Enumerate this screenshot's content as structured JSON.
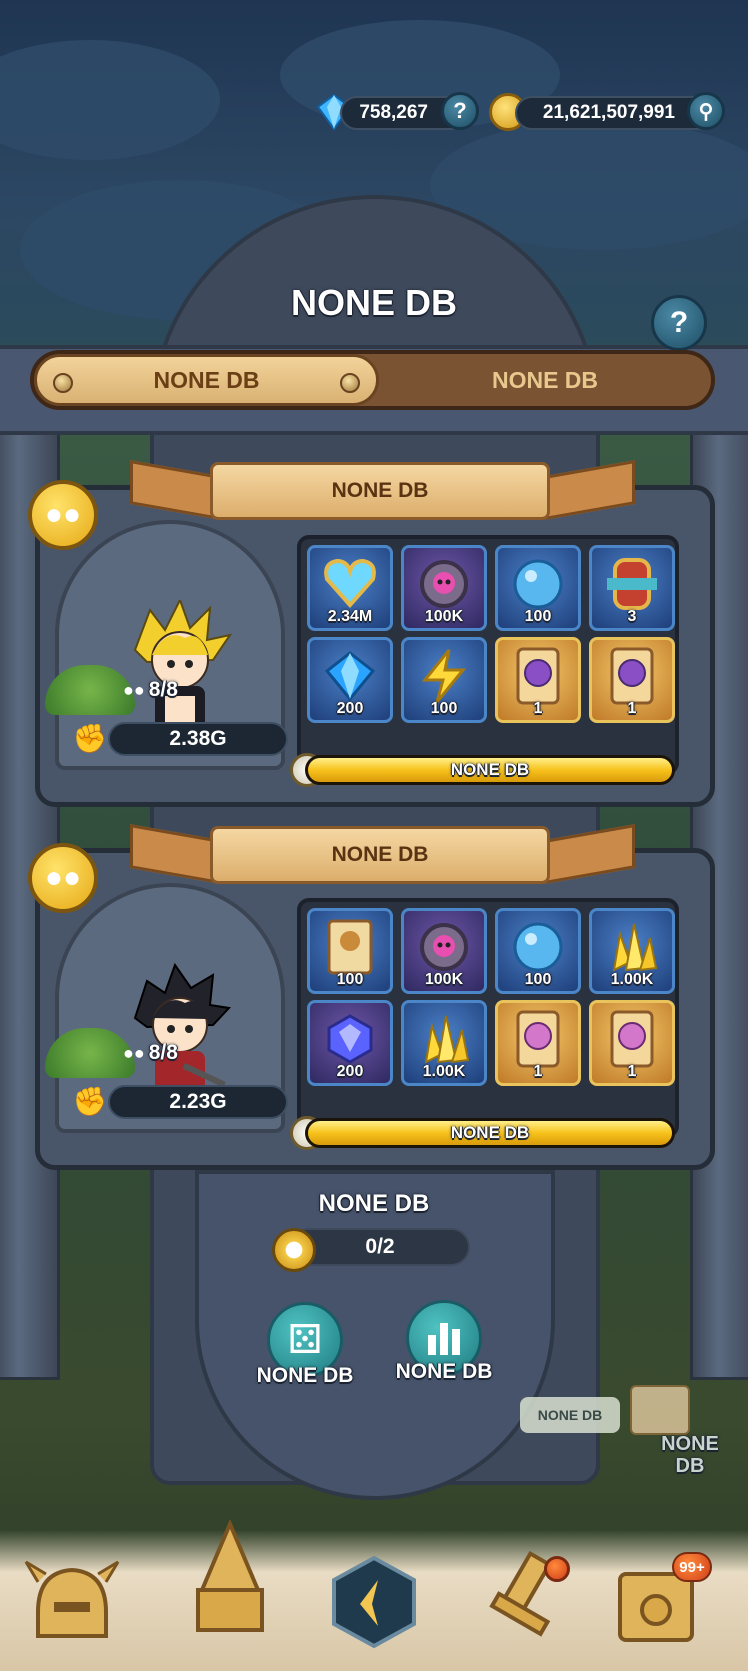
{
  "header": {
    "gems": "758,267",
    "gold": "21,621,507,991",
    "gems_help_icon": "question-icon",
    "gold_search_icon": "magnifier-icon"
  },
  "page": {
    "title": "NONE DB",
    "help_icon": "question-icon"
  },
  "tabs": [
    {
      "label": "NONE DB",
      "active": true
    },
    {
      "label": "NONE DB",
      "active": false
    }
  ],
  "panels": [
    {
      "banner": "NONE DB",
      "hero": "blonde-hero",
      "count": "8/8",
      "power": "2.38G",
      "progress_label": "NONE DB",
      "progress_percent": 100,
      "items": [
        {
          "icon": "heart-gem-icon",
          "qty": "2.34M",
          "style": "blue"
        },
        {
          "icon": "skull-token-icon",
          "qty": "100K",
          "style": "purple"
        },
        {
          "icon": "blue-orb-icon",
          "qty": "100",
          "style": "blue"
        },
        {
          "icon": "scroll-armor-icon",
          "qty": "3",
          "style": "blue"
        },
        {
          "icon": "diamond-icon",
          "qty": "200",
          "style": "blue"
        },
        {
          "icon": "lightning-icon",
          "qty": "100",
          "style": "blue"
        },
        {
          "icon": "tome-icon",
          "qty": "1",
          "style": "gold"
        },
        {
          "icon": "tome-icon",
          "qty": "1",
          "style": "gold"
        }
      ]
    },
    {
      "banner": "NONE DB",
      "hero": "dark-haired-hero",
      "count": "8/8",
      "power": "2.23G",
      "progress_label": "NONE DB",
      "progress_percent": 100,
      "items": [
        {
          "icon": "boar-hat-card-icon",
          "qty": "100",
          "style": "blue"
        },
        {
          "icon": "skull-token-icon",
          "qty": "100K",
          "style": "purple"
        },
        {
          "icon": "blue-orb-icon",
          "qty": "100",
          "style": "blue"
        },
        {
          "icon": "gold-crystal-icon",
          "qty": "1.00K",
          "style": "blue"
        },
        {
          "icon": "sapphire-icon",
          "qty": "200",
          "style": "purple"
        },
        {
          "icon": "gold-crystal-icon",
          "qty": "1.00K",
          "style": "blue"
        },
        {
          "icon": "tome-icon",
          "qty": "1",
          "style": "gold"
        },
        {
          "icon": "tome-icon",
          "qty": "1",
          "style": "gold"
        }
      ]
    }
  ],
  "summary": {
    "label": "NONE DB",
    "progress": "0/2",
    "compass_icon": "compass-icon"
  },
  "actions": [
    {
      "label": "NONE DB",
      "icon": "dice-icon"
    },
    {
      "label": "NONE DB",
      "icon": "bar-chart-icon"
    }
  ],
  "side_event": {
    "tag": "NONE DB",
    "label_line1": "NONE",
    "label_line2": "DB",
    "icon": "map-scroll-icon"
  },
  "bottom_nav": [
    {
      "icon": "helmet-icon"
    },
    {
      "icon": "tower-icon"
    },
    {
      "icon": "home-emblem-icon"
    },
    {
      "icon": "sword-icon",
      "badge_dot": true
    },
    {
      "icon": "chest-icon",
      "badge": "99+"
    }
  ]
}
